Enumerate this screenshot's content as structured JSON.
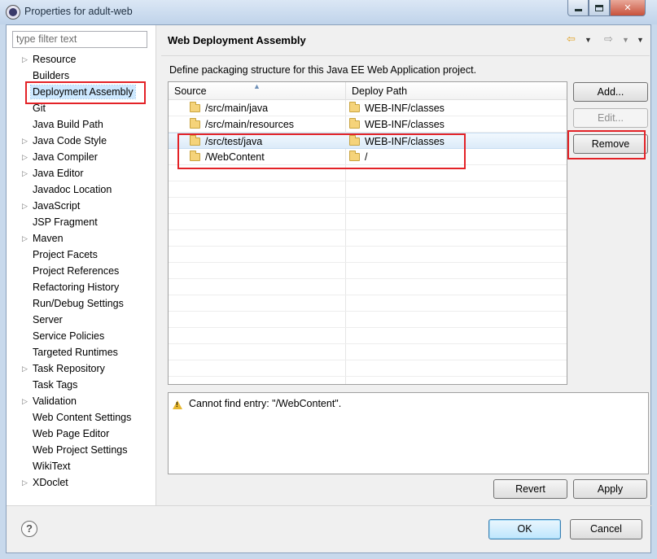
{
  "window": {
    "title": "Properties for adult-web"
  },
  "filter": {
    "placeholder": "type filter text"
  },
  "nav_tree": [
    {
      "label": "Resource",
      "expandable": true
    },
    {
      "label": "Builders",
      "expandable": false
    },
    {
      "label": "Deployment Assembly",
      "expandable": false,
      "selected": true
    },
    {
      "label": "Git",
      "expandable": false
    },
    {
      "label": "Java Build Path",
      "expandable": false
    },
    {
      "label": "Java Code Style",
      "expandable": true
    },
    {
      "label": "Java Compiler",
      "expandable": true
    },
    {
      "label": "Java Editor",
      "expandable": true
    },
    {
      "label": "Javadoc Location",
      "expandable": false
    },
    {
      "label": "JavaScript",
      "expandable": true
    },
    {
      "label": "JSP Fragment",
      "expandable": false
    },
    {
      "label": "Maven",
      "expandable": true
    },
    {
      "label": "Project Facets",
      "expandable": false
    },
    {
      "label": "Project References",
      "expandable": false
    },
    {
      "label": "Refactoring History",
      "expandable": false
    },
    {
      "label": "Run/Debug Settings",
      "expandable": false
    },
    {
      "label": "Server",
      "expandable": false
    },
    {
      "label": "Service Policies",
      "expandable": false
    },
    {
      "label": "Targeted Runtimes",
      "expandable": false
    },
    {
      "label": "Task Repository",
      "expandable": true
    },
    {
      "label": "Task Tags",
      "expandable": false
    },
    {
      "label": "Validation",
      "expandable": true
    },
    {
      "label": "Web Content Settings",
      "expandable": false
    },
    {
      "label": "Web Page Editor",
      "expandable": false
    },
    {
      "label": "Web Project Settings",
      "expandable": false
    },
    {
      "label": "WikiText",
      "expandable": false
    },
    {
      "label": "XDoclet",
      "expandable": true
    }
  ],
  "page": {
    "title": "Web Deployment Assembly",
    "description": "Define packaging structure for this Java EE Web Application project."
  },
  "table": {
    "columns": [
      "Source",
      "Deploy Path"
    ],
    "rows": [
      {
        "source": "/src/main/java",
        "deploy_path": "WEB-INF/classes"
      },
      {
        "source": "/src/main/resources",
        "deploy_path": "WEB-INF/classes"
      },
      {
        "source": "/src/test/java",
        "deploy_path": "WEB-INF/classes"
      },
      {
        "source": "/WebContent",
        "deploy_path": "/"
      }
    ]
  },
  "side_buttons": {
    "add": "Add...",
    "edit": "Edit...",
    "remove": "Remove"
  },
  "message": {
    "text": "Cannot find entry: \"/WebContent\"."
  },
  "page_buttons": {
    "revert": "Revert",
    "apply": "Apply"
  },
  "dialog_buttons": {
    "ok": "OK",
    "cancel": "Cancel",
    "help": "?"
  },
  "colors": {
    "annotation_red": "#e32227",
    "selection": "#cce8ff",
    "warning": "#e8b830"
  }
}
